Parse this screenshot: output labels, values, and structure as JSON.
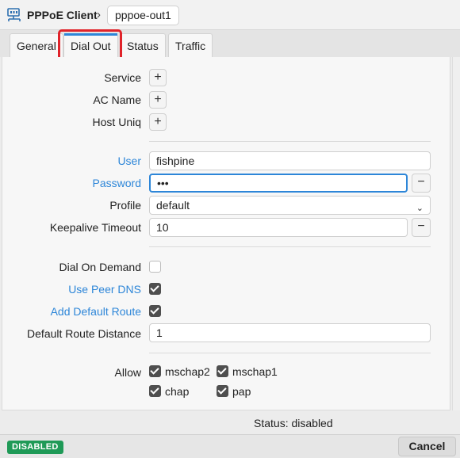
{
  "window": {
    "title": "PPPoE Client",
    "separator": "›",
    "crumb": "pppoe-out1",
    "icon": "network-interface-icon"
  },
  "tabs": [
    {
      "label": "General",
      "active": false
    },
    {
      "label": "Dial Out",
      "active": true
    },
    {
      "label": "Status",
      "active": false
    },
    {
      "label": "Traffic",
      "active": false
    }
  ],
  "form": {
    "service_label": "Service",
    "ac_name_label": "AC Name",
    "host_uniq_label": "Host Uniq",
    "add_symbol": "+",
    "remove_symbol": "−",
    "user_label": "User",
    "user_value": "fishpine",
    "password_label": "Password",
    "password_value": "•••",
    "profile_label": "Profile",
    "profile_value": "default",
    "keepalive_label": "Keepalive Timeout",
    "keepalive_value": "10",
    "dial_on_demand_label": "Dial On Demand",
    "dial_on_demand_checked": false,
    "use_peer_dns_label": "Use Peer DNS",
    "use_peer_dns_checked": true,
    "add_default_route_label": "Add Default Route",
    "add_default_route_checked": true,
    "default_route_distance_label": "Default Route Distance",
    "default_route_distance_value": "1",
    "allow_label": "Allow",
    "allow_options": [
      {
        "label": "mschap2",
        "checked": true
      },
      {
        "label": "mschap1",
        "checked": true
      },
      {
        "label": "chap",
        "checked": true
      },
      {
        "label": "pap",
        "checked": true
      }
    ]
  },
  "status_line": "Status: disabled",
  "footer": {
    "badge": "DISABLED",
    "cancel_label": "Cancel"
  },
  "colors": {
    "accent": "#2d86d8",
    "highlight": "#e0232a",
    "badge": "#1f9a57"
  }
}
